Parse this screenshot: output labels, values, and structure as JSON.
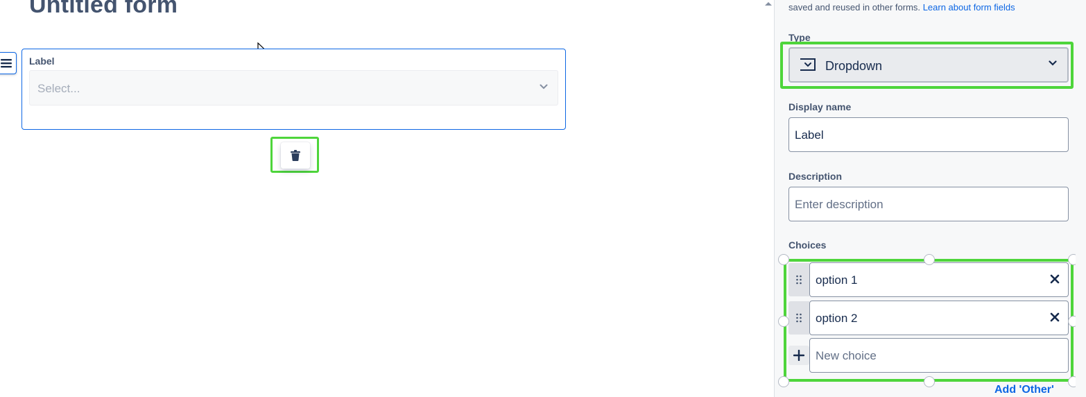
{
  "form": {
    "title": "Untitled form",
    "field": {
      "label": "Label",
      "select_placeholder": "Select..."
    }
  },
  "panel": {
    "note_text": "saved and reused in other forms.",
    "note_link": "Learn about form fields",
    "type_label": "Type",
    "type_value": "Dropdown",
    "display_name_label": "Display name",
    "display_name_value": "Label",
    "description_label": "Description",
    "description_placeholder": "Enter description",
    "choices_label": "Choices",
    "choices": [
      "option 1",
      "option 2"
    ],
    "new_choice_placeholder": "New choice",
    "add_other_label": "Add 'Other'"
  },
  "icons": {
    "drag": "hamburger-icon",
    "delete": "trash-icon",
    "type": "dropdown-icon",
    "chevron": "chevron-down-icon",
    "grip": "grip-dots-icon",
    "remove": "close-icon",
    "add": "plus-icon"
  },
  "colors": {
    "accent": "#0c66e4",
    "highlight": "#4ed53b",
    "title": "#44546f"
  }
}
